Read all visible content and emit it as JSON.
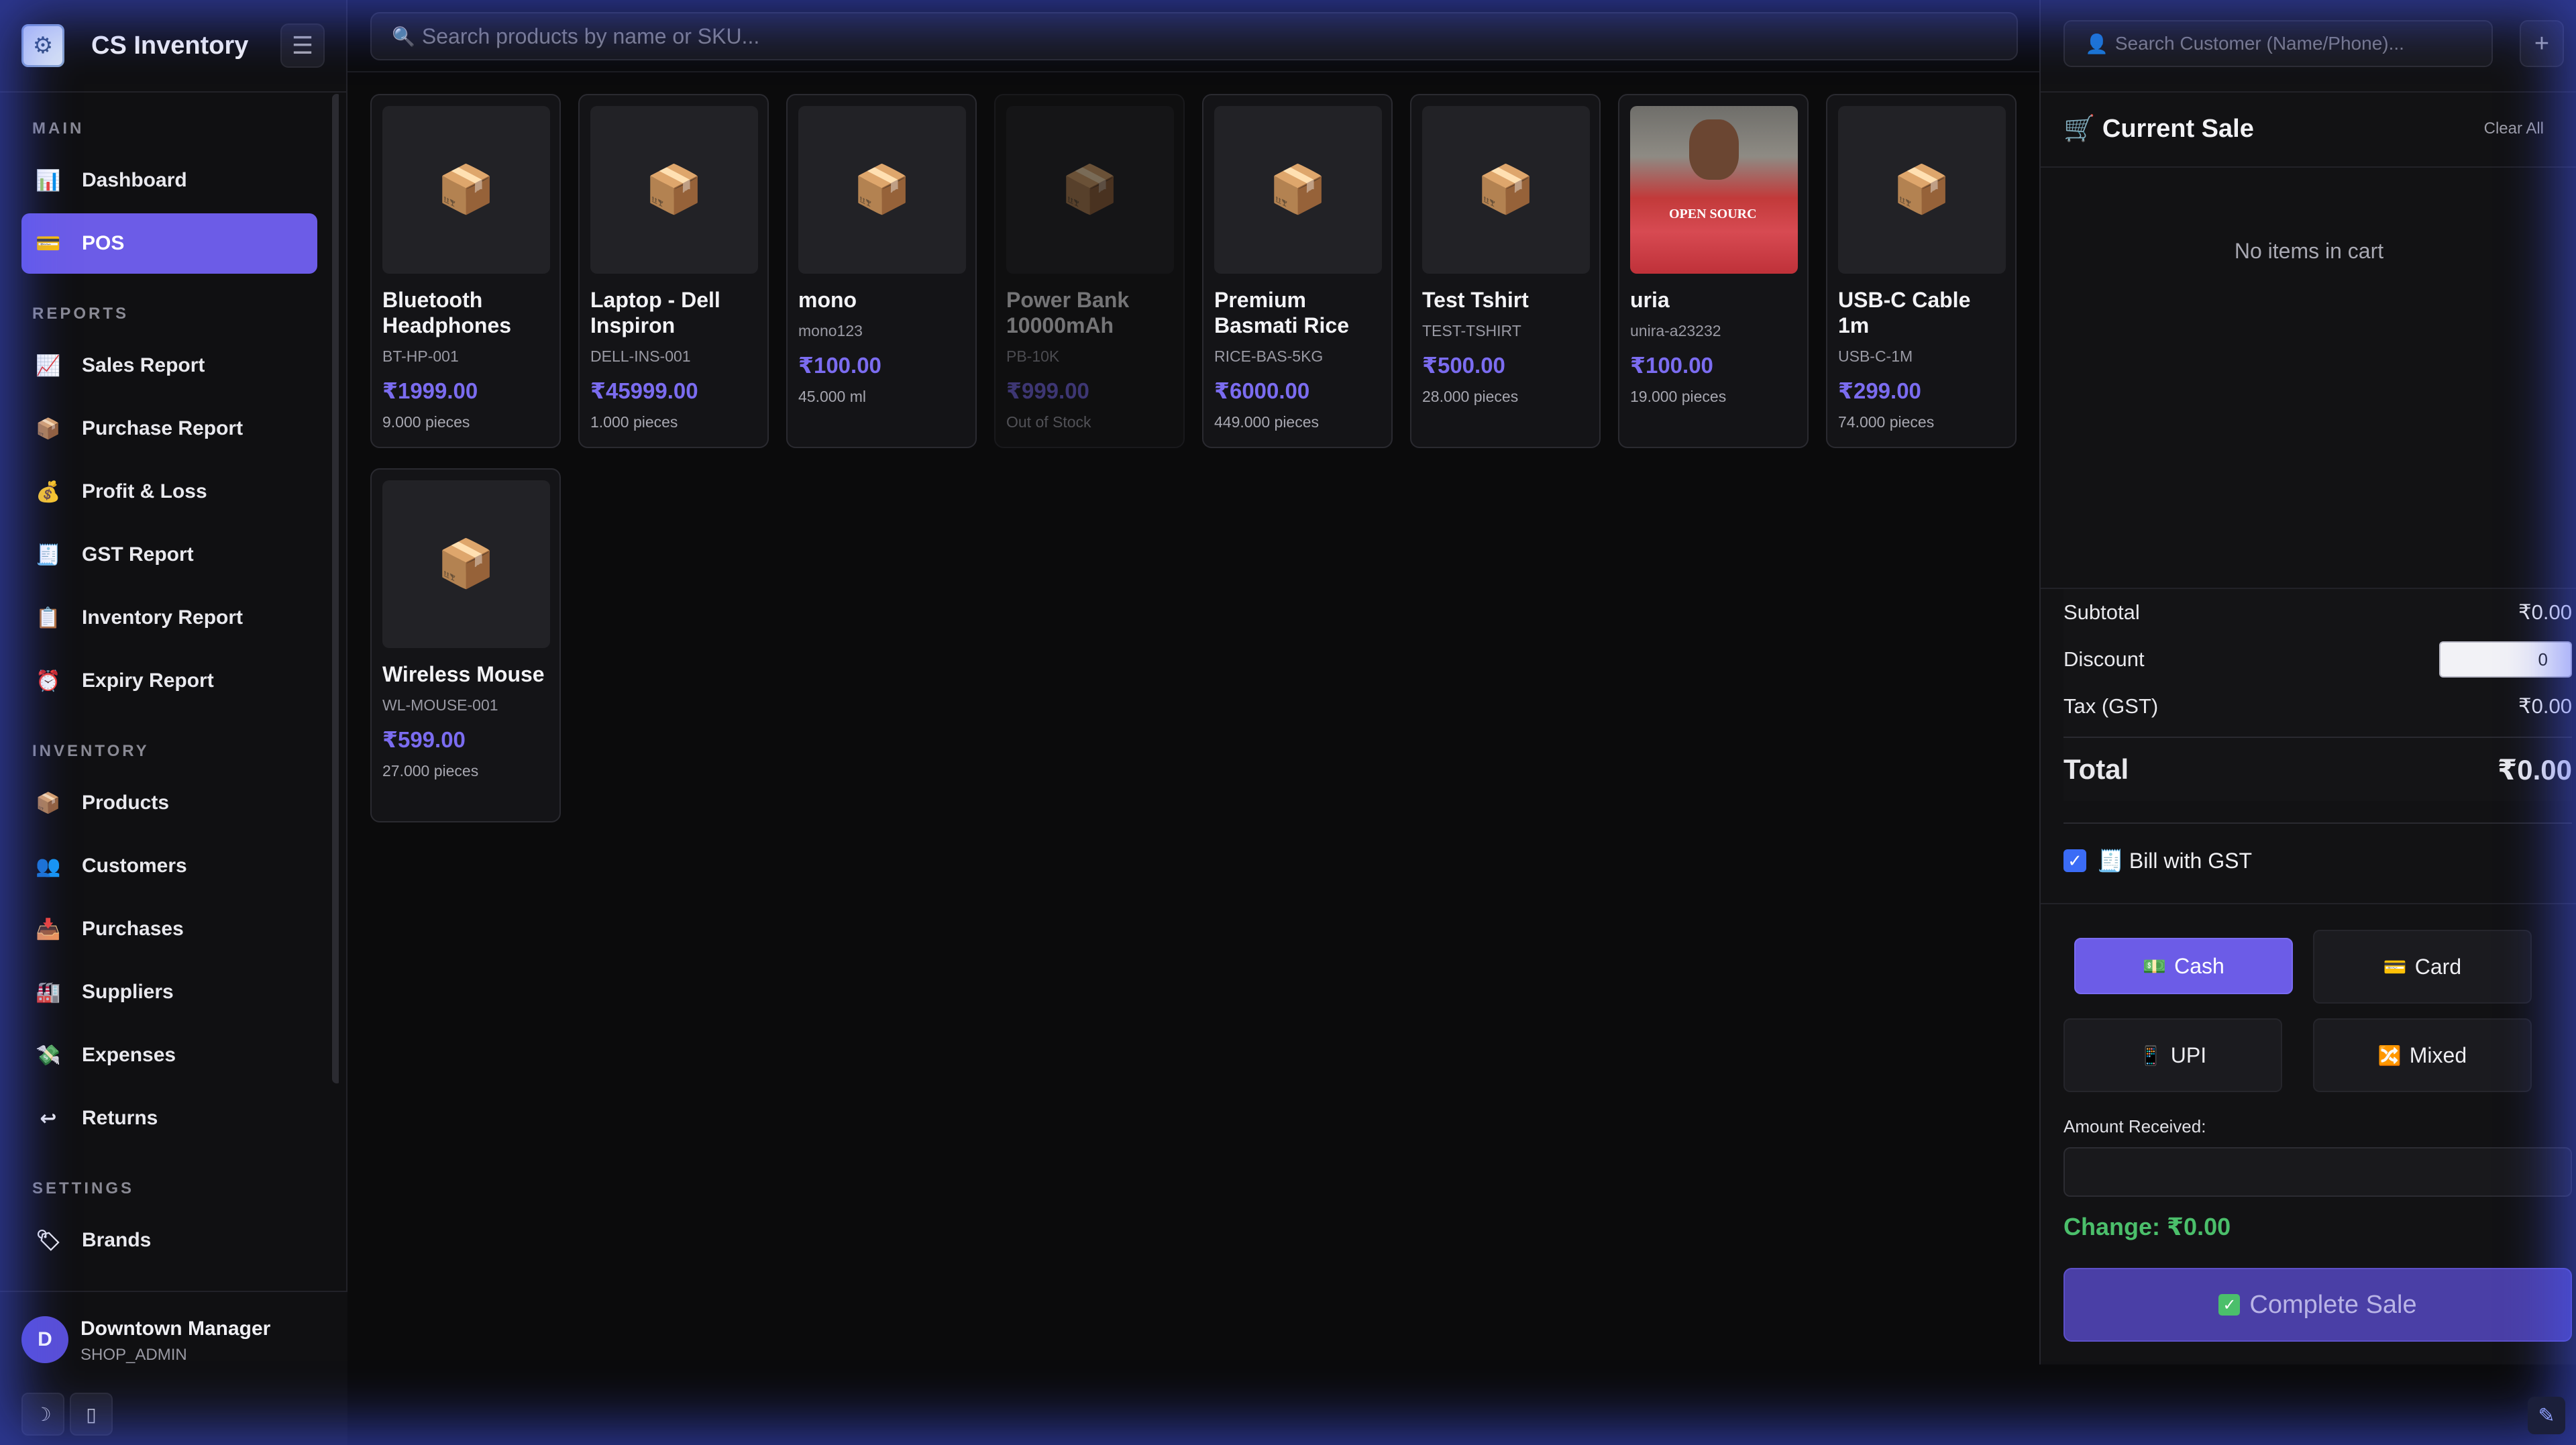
{
  "app": {
    "title": "CS Inventory"
  },
  "sidebar": {
    "sections": [
      {
        "label": "MAIN",
        "items": [
          {
            "icon": "📊",
            "label": "Dashboard",
            "active": false
          },
          {
            "icon": "💳",
            "label": "POS",
            "active": true
          }
        ]
      },
      {
        "label": "REPORTS",
        "items": [
          {
            "icon": "📈",
            "label": "Sales Report",
            "active": false
          },
          {
            "icon": "📦",
            "label": "Purchase Report",
            "active": false
          },
          {
            "icon": "💰",
            "label": "Profit & Loss",
            "active": false
          },
          {
            "icon": "🧾",
            "label": "GST Report",
            "active": false
          },
          {
            "icon": "📋",
            "label": "Inventory Report",
            "active": false
          },
          {
            "icon": "⏰",
            "label": "Expiry Report",
            "active": false
          }
        ]
      },
      {
        "label": "INVENTORY",
        "items": [
          {
            "icon": "📦",
            "label": "Products",
            "active": false
          },
          {
            "icon": "👥",
            "label": "Customers",
            "active": false
          },
          {
            "icon": "📥",
            "label": "Purchases",
            "active": false
          },
          {
            "icon": "🏭",
            "label": "Suppliers",
            "active": false
          },
          {
            "icon": "💸",
            "label": "Expenses",
            "active": false
          },
          {
            "icon": "↩",
            "label": "Returns",
            "active": false
          }
        ]
      },
      {
        "label": "SETTINGS",
        "items": [
          {
            "icon": "🏷",
            "label": "Brands",
            "active": false
          }
        ]
      }
    ],
    "user": {
      "initial": "D",
      "name": "Downtown Manager",
      "role": "SHOP_ADMIN"
    }
  },
  "search": {
    "placeholder": "Search products by name or SKU..."
  },
  "products": [
    {
      "name": "Bluetooth Headphones",
      "sku": "BT-HP-001",
      "price": "₹1999.00",
      "stock": "9.000 pieces",
      "out_of_stock": false,
      "photo": false
    },
    {
      "name": "Laptop - Dell Inspiron",
      "sku": "DELL-INS-001",
      "price": "₹45999.00",
      "stock": "1.000 pieces",
      "out_of_stock": false,
      "photo": false
    },
    {
      "name": "mono",
      "sku": "mono123",
      "price": "₹100.00",
      "stock": "45.000 ml",
      "out_of_stock": false,
      "photo": false
    },
    {
      "name": "Power Bank 10000mAh",
      "sku": "PB-10K",
      "price": "₹999.00",
      "stock": "Out of Stock",
      "out_of_stock": true,
      "photo": false
    },
    {
      "name": "Premium Basmati Rice",
      "sku": "RICE-BAS-5KG",
      "price": "₹6000.00",
      "stock": "449.000 pieces",
      "out_of_stock": false,
      "photo": false
    },
    {
      "name": "Test Tshirt",
      "sku": "TEST-TSHIRT",
      "price": "₹500.00",
      "stock": "28.000 pieces",
      "out_of_stock": false,
      "photo": false
    },
    {
      "name": "uria",
      "sku": "unira-a23232",
      "price": "₹100.00",
      "stock": "19.000 pieces",
      "out_of_stock": false,
      "photo": true,
      "photo_text": "OPEN SOURC"
    },
    {
      "name": "USB-C Cable 1m",
      "sku": "USB-C-1M",
      "price": "₹299.00",
      "stock": "74.000 pieces",
      "out_of_stock": false,
      "photo": false
    },
    {
      "name": "Wireless Mouse",
      "sku": "WL-MOUSE-001",
      "price": "₹599.00",
      "stock": "27.000 pieces",
      "out_of_stock": false,
      "photo": false
    }
  ],
  "cart": {
    "customer_placeholder": "Search Customer (Name/Phone)...",
    "add_customer": "+",
    "title": "Current Sale",
    "clear_label": "Clear All",
    "empty_text": "No items in cart",
    "subtotal_label": "Subtotal",
    "subtotal": "₹0.00",
    "discount_label": "Discount",
    "discount": "0",
    "tax_label": "Tax (GST)",
    "tax": "₹0.00",
    "total_label": "Total",
    "total": "₹0.00",
    "gst_label": "Bill with GST",
    "gst_checked": true,
    "payment_methods": [
      {
        "icon": "💵",
        "label": "Cash",
        "active": true
      },
      {
        "icon": "💳",
        "label": "Card",
        "active": false
      },
      {
        "icon": "📱",
        "label": "UPI",
        "active": false
      },
      {
        "icon": "🔀",
        "label": "Mixed",
        "active": false
      }
    ],
    "amount_label": "Amount Received:",
    "amount_value": "",
    "change_text": "Change: ₹0.00",
    "complete_label": "Complete Sale"
  },
  "colors": {
    "accent": "#6c5ce7",
    "price": "#7b6cf0",
    "success": "#4bbf6b"
  }
}
